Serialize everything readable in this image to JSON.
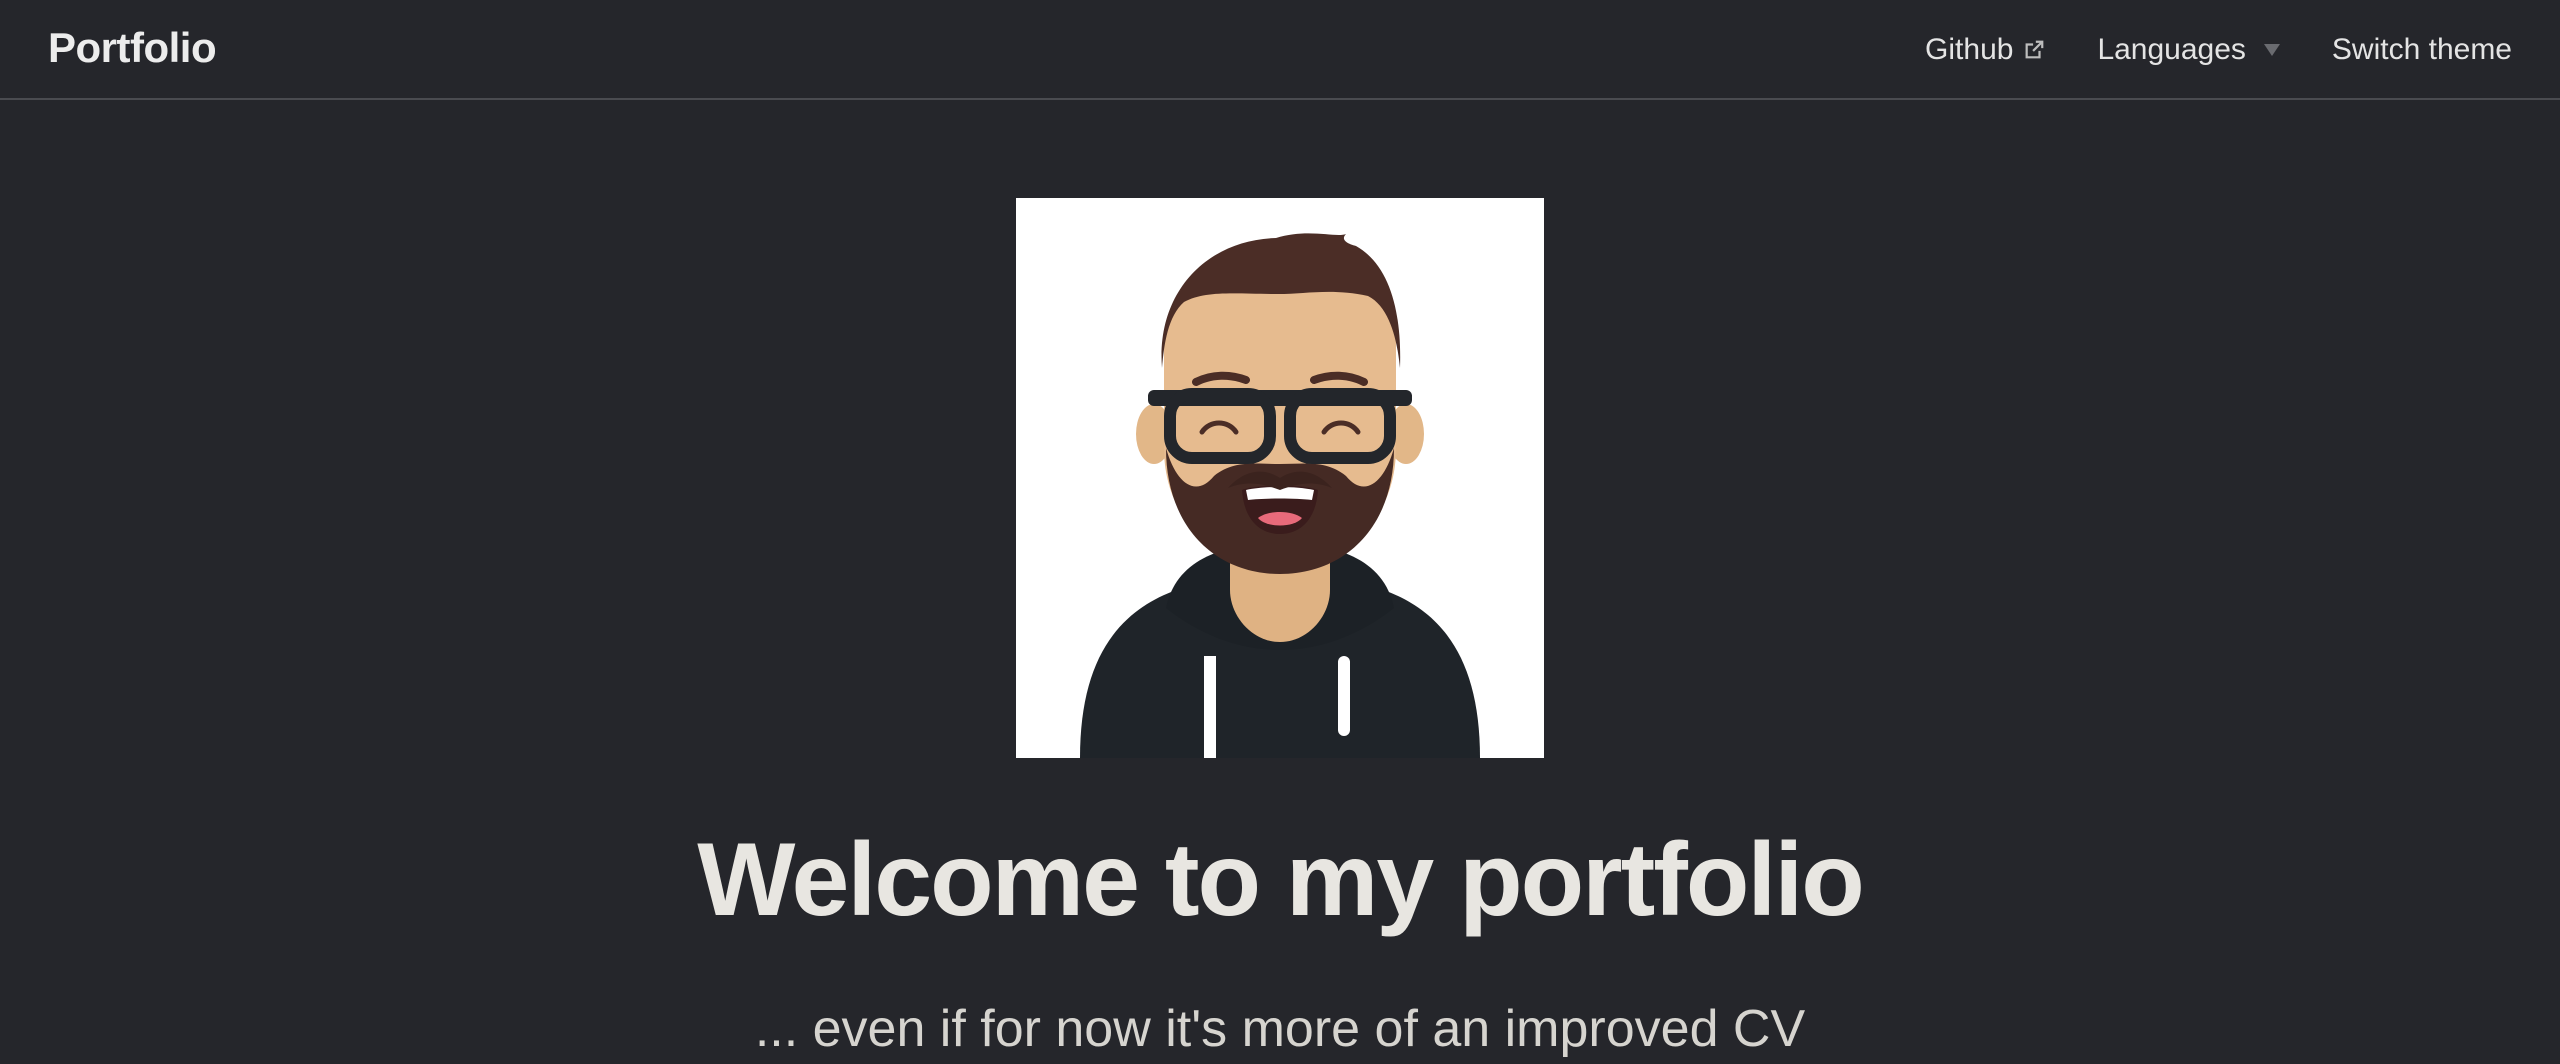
{
  "navbar": {
    "brand": "Portfolio",
    "items": [
      {
        "label": "Github",
        "icon": "external-link-icon"
      },
      {
        "label": "Languages",
        "icon": "caret-down-icon"
      },
      {
        "label": "Switch theme"
      }
    ]
  },
  "hero": {
    "avatar_icon": "avatar-illustration",
    "title": "Welcome to my portfolio",
    "subtitle": "... even if for now it's more of an improved CV"
  },
  "colors": {
    "background": "#25262b",
    "text": "#e4e4e4",
    "divider": "#4a4b50"
  }
}
